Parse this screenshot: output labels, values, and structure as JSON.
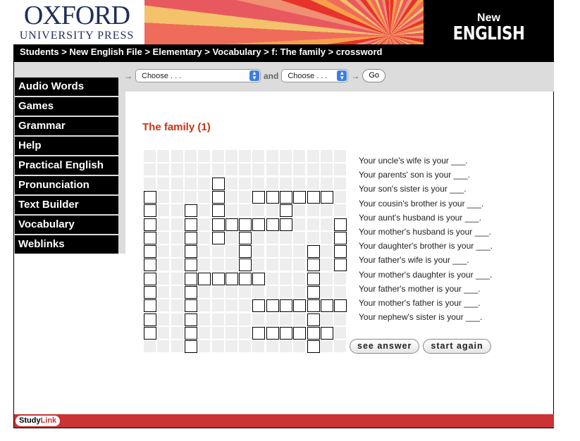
{
  "header": {
    "logo_line1": "OXFORD",
    "logo_line2": "UNIVERSITY PRESS",
    "brand_new": "New",
    "brand_title": "ENGLISH FILE"
  },
  "breadcrumb": "Students > New English File > Elementary > Vocabulary > f: The family > crossword",
  "nav": {
    "arrow": "→",
    "select1": "Choose . . .",
    "and": "and",
    "select2": "Choose . . .",
    "go": "Go"
  },
  "sidebar": {
    "items": [
      {
        "label": "Audio Words"
      },
      {
        "label": "Games"
      },
      {
        "label": "Grammar"
      },
      {
        "label": "Help"
      },
      {
        "label": "Practical English"
      },
      {
        "label": "Pronunciation"
      },
      {
        "label": "Text Builder"
      },
      {
        "label": "Vocabulary"
      },
      {
        "label": "Weblinks"
      }
    ]
  },
  "main": {
    "title": "The family (1)",
    "crossword": {
      "size": 15,
      "white_cells_by_row": [
        [],
        [],
        [
          5
        ],
        [
          0,
          5,
          8,
          9,
          10,
          11,
          12,
          13
        ],
        [
          0,
          3,
          5,
          10
        ],
        [
          0,
          3,
          5,
          6,
          7,
          8,
          9,
          10,
          14
        ],
        [
          0,
          3,
          5,
          7,
          14
        ],
        [
          0,
          3,
          7,
          12,
          14
        ],
        [
          0,
          3,
          7,
          12,
          14
        ],
        [
          0,
          3,
          4,
          5,
          6,
          7,
          8,
          12
        ],
        [
          0,
          3,
          12
        ],
        [
          0,
          3,
          8,
          9,
          10,
          11,
          12,
          13,
          14
        ],
        [
          0,
          3,
          12
        ],
        [
          0,
          3,
          8,
          9,
          10,
          11,
          12,
          13
        ],
        [
          3,
          12
        ]
      ]
    },
    "clues": [
      "Your uncle's wife is your ___.",
      "Your parents' son is your ___.",
      "Your son's sister is your ___.",
      "Your cousin's brother is your ___.",
      "Your aunt's husband is your ___.",
      "Your mother's husband is your ___.",
      "Your daughter's brother is your ___.",
      "Your father's wife is your ___.",
      "Your mother's daughter is your ___.",
      "Your father's mother is your ___.",
      "Your mother's father is your ___.",
      "Your nephew's sister is your ___."
    ],
    "see_answer": "see answer",
    "start_again": "start again"
  },
  "footer": {
    "logo_study": "Study",
    "logo_link": "Link",
    "color": "#cc3333"
  }
}
